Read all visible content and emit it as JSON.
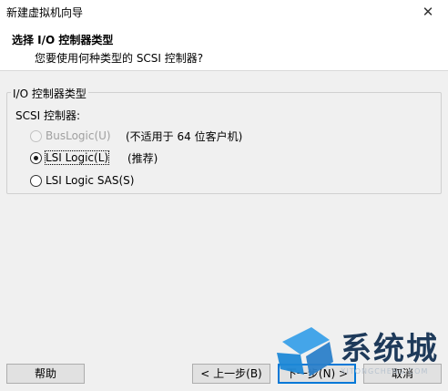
{
  "window": {
    "title": "新建虚拟机向导",
    "close_glyph": "✕"
  },
  "header": {
    "title": "选择 I/O 控制器类型",
    "subtitle": "您要使用何种类型的 SCSI 控制器?"
  },
  "group": {
    "legend": "I/O 控制器类型",
    "scsi_label": "SCSI 控制器:",
    "options": [
      {
        "label": "BusLogic(U)",
        "note": "(不适用于 64 位客户机)",
        "checked": false,
        "enabled": false
      },
      {
        "label": "LSI Logic(L)",
        "note": "(推荐)",
        "checked": true,
        "enabled": true
      },
      {
        "label": "LSI Logic SAS(S)",
        "note": "",
        "checked": false,
        "enabled": true
      }
    ]
  },
  "buttons": {
    "help": "帮助",
    "back": "< 上一步(B)",
    "next": "下一步(N) >",
    "cancel": "取消"
  },
  "watermark": {
    "text": "系统城",
    "sub": "XITONGCHENG.COM"
  },
  "colors": {
    "accent": "#0078d7",
    "watermark_blue": "#1e88d6",
    "watermark_text": "#1e3a5a"
  }
}
